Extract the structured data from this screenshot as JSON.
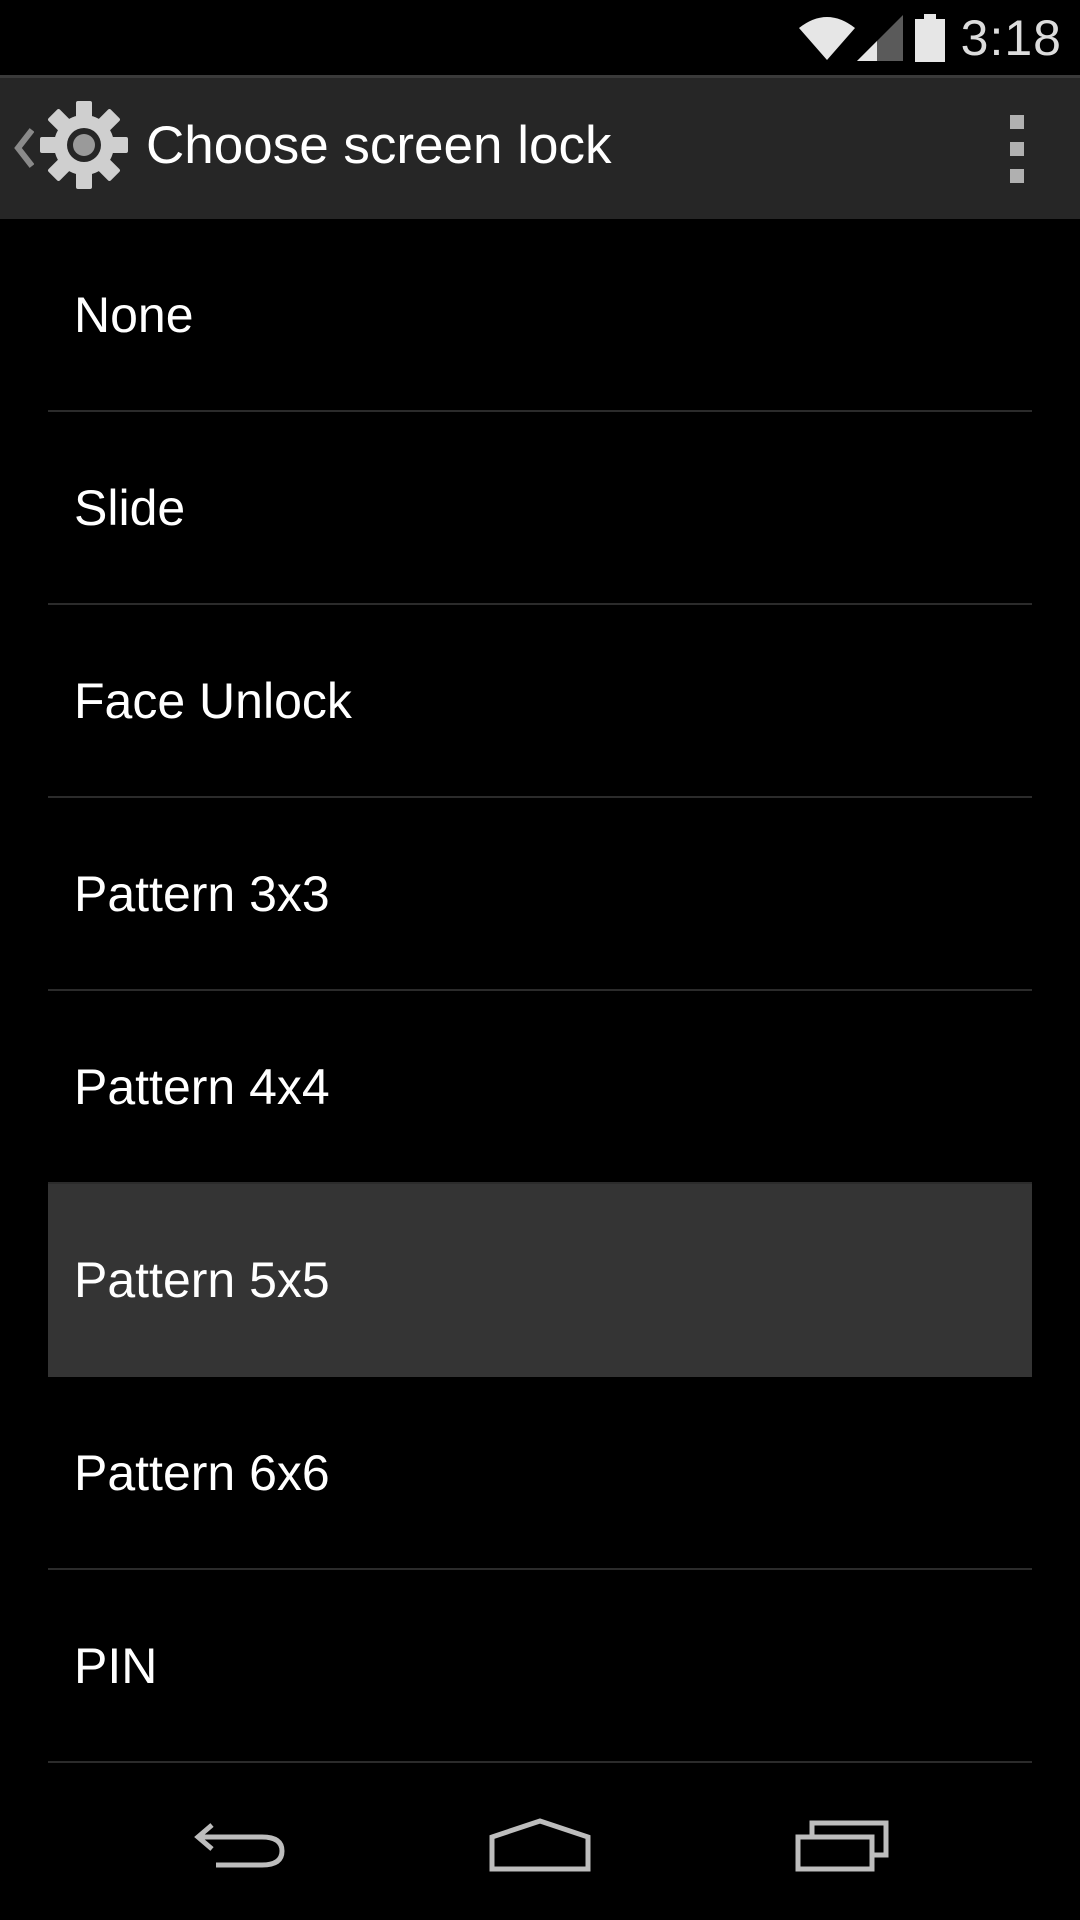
{
  "status_bar": {
    "time": "3:18",
    "icons": [
      "wifi-icon",
      "signal-icon",
      "battery-icon"
    ]
  },
  "action_bar": {
    "title": "Choose screen lock",
    "icons": [
      "back-caret-icon",
      "settings-gear-icon",
      "overflow-menu-icon"
    ]
  },
  "options": [
    {
      "label": "None",
      "selected": false
    },
    {
      "label": "Slide",
      "selected": false
    },
    {
      "label": "Face Unlock",
      "selected": false
    },
    {
      "label": "Pattern 3x3",
      "selected": false
    },
    {
      "label": "Pattern 4x4",
      "selected": false
    },
    {
      "label": "Pattern 5x5",
      "selected": true
    },
    {
      "label": "Pattern 6x6",
      "selected": false
    },
    {
      "label": "PIN",
      "selected": false
    }
  ],
  "nav_bar": {
    "icons": [
      "back-icon",
      "home-icon",
      "recent-apps-icon"
    ]
  },
  "colors": {
    "background": "#000000",
    "action_bar": "#262626",
    "selected_row": "#343434",
    "divider": "#2b2b2b",
    "text": "#ffffff"
  }
}
